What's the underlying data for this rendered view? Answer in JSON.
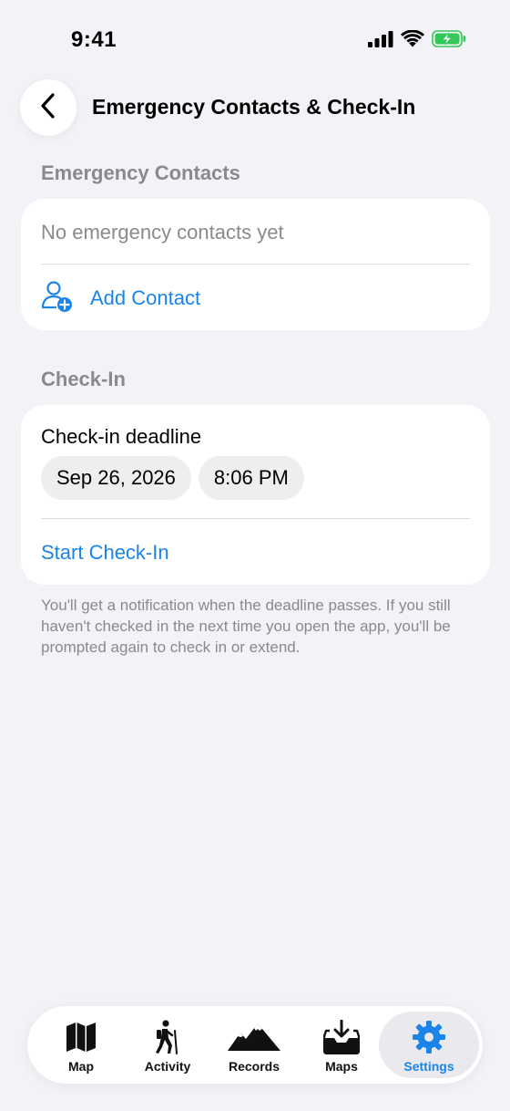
{
  "status": {
    "time": "9:41",
    "icons": [
      "cellular-icon",
      "wifi-icon",
      "battery-charging-icon"
    ],
    "battery_color": "#34c759"
  },
  "header": {
    "title": "Emergency Contacts & Check-In",
    "back_icon": "chevron-left-icon"
  },
  "contacts": {
    "section_title": "Emergency Contacts",
    "empty_text": "No emergency contacts yet",
    "add_label": "Add Contact",
    "add_icon": "person-add-icon"
  },
  "checkin": {
    "section_title": "Check-In",
    "deadline_label": "Check-in deadline",
    "date": "Sep 26, 2026",
    "time": "8:06 PM",
    "start_label": "Start Check-In",
    "footnote": "You'll get a notification when the deadline passes. If you still haven't checked in the next time you open the app, you'll be prompted again to check in or extend."
  },
  "tabs": [
    {
      "label": "Map",
      "icon": "map-icon",
      "active": false
    },
    {
      "label": "Activity",
      "icon": "hiker-icon",
      "active": false
    },
    {
      "label": "Records",
      "icon": "mountains-icon",
      "active": false
    },
    {
      "label": "Maps",
      "icon": "download-tray-icon",
      "active": false
    },
    {
      "label": "Settings",
      "icon": "gear-icon",
      "active": true
    }
  ],
  "colors": {
    "accent": "#1a84e8",
    "background": "#f2f2f7",
    "secondary_text": "#8a8a8e"
  }
}
